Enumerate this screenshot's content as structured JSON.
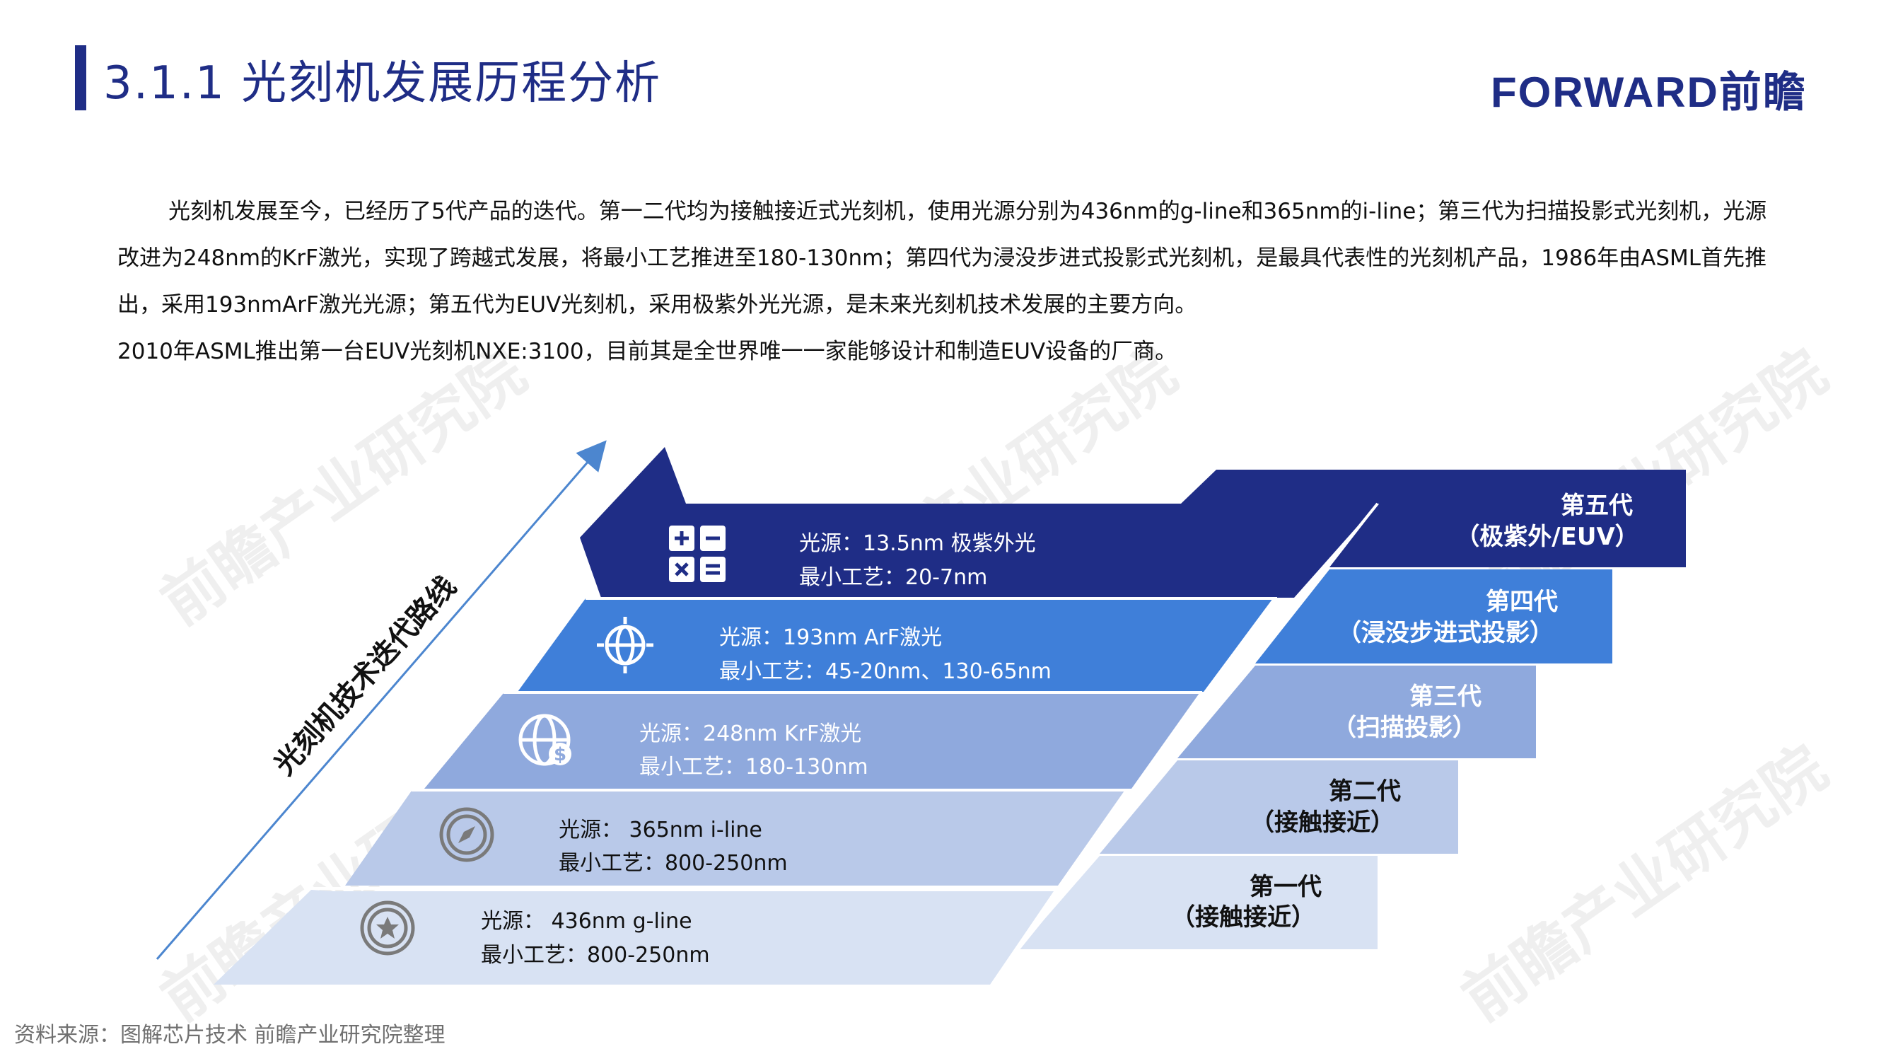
{
  "header": {
    "title": "3.1.1 光刻机发展历程分析",
    "logo_text": "FORWARD前瞻"
  },
  "intro": {
    "paragraph": "光刻机发展至今，已经历了5代产品的迭代。第一二代均为接触接近式光刻机，使用光源分别为436nm的g-line和365nm的i-line；第三代为扫描投影式光刻机，光源改进为248nm的KrF激光，实现了跨越式发展，将最小工艺推进至180-130nm；第四代为浸没步进式投影式光刻机，是最具代表性的光刻机产品，1986年由ASML首先推出，采用193nmArF激光光源；第五代为EUV光刻机，采用极紫外光光源，是未来光刻机技术发展的主要方向。",
    "paragraph2": "2010年ASML推出第一台EUV光刻机NXE:3100，目前其是全世界唯一一家能够设计和制造EUV设备的厂商。"
  },
  "diagram": {
    "arrow_label": "光刻机技术迭代路线",
    "colors": {
      "gen5": "#1f2d86",
      "gen4": "#3f7fd9",
      "gen3": "#8fa9dd",
      "gen2": "#b9c9e9",
      "gen1": "#d8e2f3",
      "icon": "#7a7a7a",
      "arrow": "#4c86cf"
    },
    "generations": [
      {
        "name": "第一代",
        "type": "（接触接近）",
        "source": "光源： 436nm g-line",
        "process": "最小工艺：800-250nm",
        "icon": "star-badge-icon"
      },
      {
        "name": "第二代",
        "type": "（接触接近）",
        "source": "光源： 365nm i-line",
        "process": "最小工艺：800-250nm",
        "icon": "compass-icon"
      },
      {
        "name": "第三代",
        "type": "（扫描投影）",
        "source": "光源：248nm KrF激光",
        "process": "最小工艺：180-130nm",
        "icon": "globe-dollar-icon"
      },
      {
        "name": "第四代",
        "type": "（浸没步进式投影）",
        "source": "光源：193nm ArF激光",
        "process": "最小工艺：45-20nm、130-65nm",
        "icon": "globe-target-icon"
      },
      {
        "name": "第五代",
        "type": "（极紫外/EUV）",
        "source": "光源：13.5nm 极紫外光",
        "process": "最小工艺：20-7nm",
        "icon": "calculator-icon"
      }
    ]
  },
  "watermark": {
    "text": "前瞻产业研究院"
  },
  "footer": {
    "source": "资料来源：图解芯片技术 前瞻产业研究院整理"
  }
}
